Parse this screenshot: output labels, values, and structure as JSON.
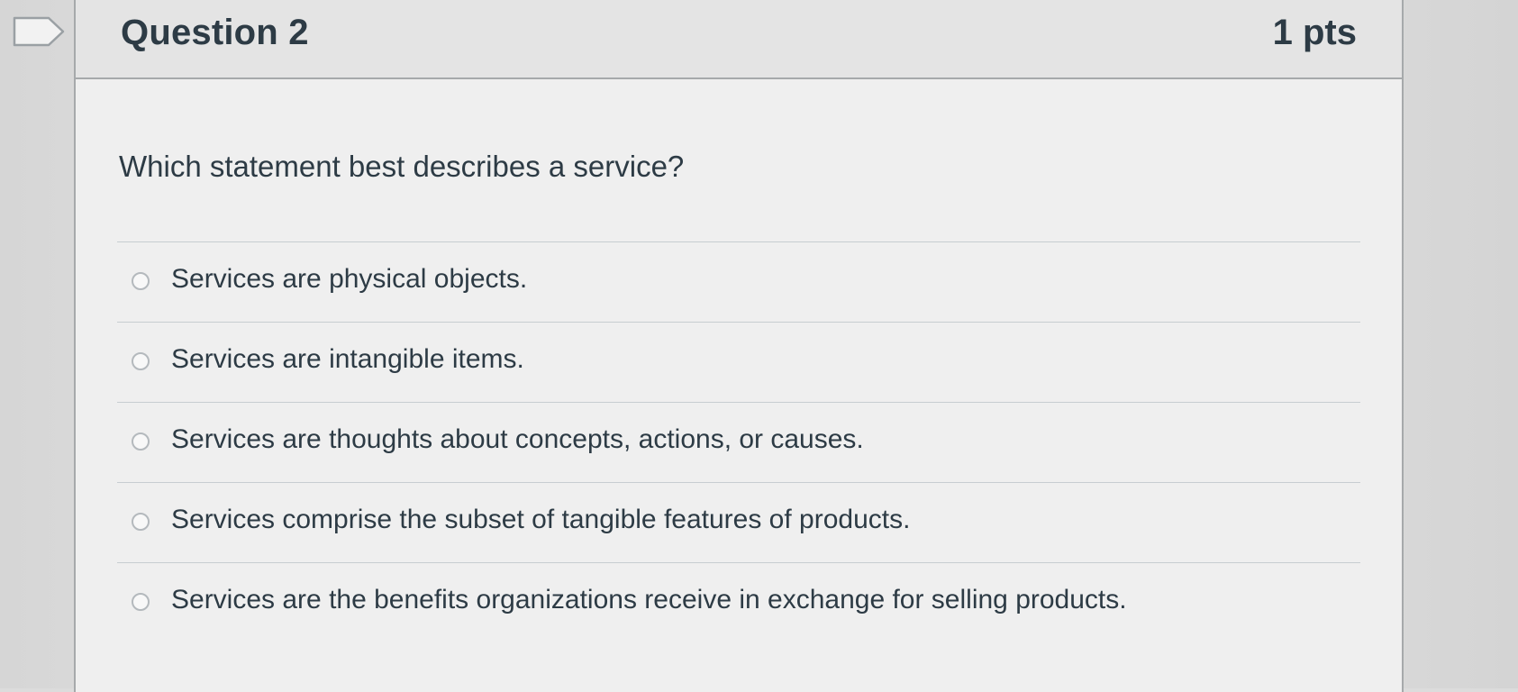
{
  "question": {
    "title": "Question 2",
    "points": "1 pts",
    "text": "Which statement best describes a service?",
    "answers": [
      {
        "label": "Services are physical objects.",
        "selected": false
      },
      {
        "label": "Services are intangible items.",
        "selected": false
      },
      {
        "label": "Services are thoughts about concepts, actions, or causes.",
        "selected": false
      },
      {
        "label": "Services comprise the subset of tangible features of products.",
        "selected": false
      },
      {
        "label": "Services are the benefits organizations receive in exchange for selling products.",
        "selected": false
      }
    ]
  },
  "icons": {
    "flag": "flag-question-icon",
    "radio": "radio-button-icon"
  },
  "colors": {
    "text": "#2d3b45",
    "border": "#a6a9ab",
    "divider": "#c7cdd1"
  }
}
